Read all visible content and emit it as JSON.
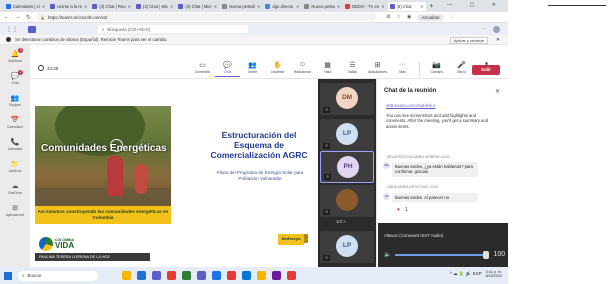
{
  "browser": {
    "tabs": [
      {
        "title": "Calendario | cl",
        "color": "#1a73e8",
        "active": false
      },
      {
        "title": "Unirse a la re",
        "color": "#5b5fc7",
        "active": false
      },
      {
        "title": "(4) Chat | Reu",
        "color": "#5b5fc7",
        "active": false
      },
      {
        "title": "(3) Chat | Mic",
        "color": "#5b5fc7",
        "active": false
      },
      {
        "title": "(3) Chat | Micr",
        "color": "#5b5fc7",
        "active": false
      },
      {
        "title": "Nueva pestañ",
        "color": "#888888",
        "active": false
      },
      {
        "title": "dgo directo",
        "color": "#4285f4",
        "active": false
      },
      {
        "title": "Nueva pesta",
        "color": "#888888",
        "active": false
      },
      {
        "title": "DEDO - TV en",
        "color": "#e53935",
        "active": false
      },
      {
        "title": "(8) Chat",
        "color": "#5b5fc7",
        "active": true
      }
    ],
    "new_tab": "+",
    "window_controls": "— ▢ ✕",
    "url": "https://teams.microsoft.com/v2/",
    "update_label": "Actualizar"
  },
  "teams_header": {
    "search_placeholder": "Búsqueda (Ctrl+Alt+E)",
    "more": "···"
  },
  "banner": {
    "text": "Se detectaron cambios de idioma (Español). Reinicie Teams para ver el cambio.",
    "action": "Aplicar y reiniciar",
    "close": "✕"
  },
  "rail": [
    {
      "icon": "bell-icon",
      "glyph": "🔔",
      "label": "Actividad",
      "badge": "1"
    },
    {
      "icon": "chat-icon",
      "glyph": "💬",
      "label": "Chat",
      "badge": "2"
    },
    {
      "icon": "teams-icon",
      "glyph": "👥",
      "label": "Equipos",
      "badge": ""
    },
    {
      "icon": "calendar-icon",
      "glyph": "📅",
      "label": "Calendario",
      "badge": ""
    },
    {
      "icon": "calls-icon",
      "glyph": "📞",
      "label": "Llamadas",
      "badge": ""
    },
    {
      "icon": "files-icon",
      "glyph": "📁",
      "label": "Archivos",
      "badge": ""
    },
    {
      "icon": "onedrive-icon",
      "glyph": "☁",
      "label": "OneDrive",
      "badge": ""
    },
    {
      "icon": "apps-icon",
      "glyph": "⊞",
      "label": "Aplicaciones",
      "badge": ""
    }
  ],
  "meeting": {
    "timer": "43:35",
    "tools": [
      {
        "icon": "chat-icon",
        "glyph": "💬",
        "label": "Chat",
        "active": true
      },
      {
        "icon": "people-icon",
        "glyph": "👥",
        "label": "Gente",
        "active": false
      },
      {
        "icon": "raise-hand-icon",
        "glyph": "✋",
        "label": "Levantar",
        "active": false
      },
      {
        "icon": "react-icon",
        "glyph": "☺",
        "label": "Reaccionar",
        "active": false
      },
      {
        "icon": "view-icon",
        "glyph": "▦",
        "label": "Vista",
        "active": false
      },
      {
        "icon": "notes-icon",
        "glyph": "☰",
        "label": "Notas",
        "active": false
      },
      {
        "icon": "apps-icon",
        "glyph": "⊞",
        "label": "Aplicaciones",
        "active": false
      },
      {
        "icon": "more-icon",
        "glyph": "···",
        "label": "Más",
        "active": false
      }
    ],
    "extra_label": "Contenido",
    "devices": [
      {
        "icon": "camera-icon",
        "glyph": "📷",
        "label": "Cámara"
      },
      {
        "icon": "mic-icon",
        "glyph": "🎤",
        "label": "Micro"
      },
      {
        "icon": "share-icon",
        "glyph": "⬆",
        "label": "Compartir"
      }
    ],
    "leave_label": "Salir"
  },
  "slide": {
    "photo_title": "Comunidades Energéticas",
    "strip_text": "Así estamos construyendo las comunidades energéticas en Colombia",
    "title": "Estructuración del Esquema de Comercialización AGRC",
    "subtitle": "Piloto del Programa de Energía Solar para Población Vulnerable",
    "logo_small": "COLOMBIA",
    "logo_big": "VIDA",
    "logo_tag": "MinEnergía",
    "presenter": "PAULINA TERESA LLERENA DE LA HOZ"
  },
  "participants": [
    {
      "initials": "DM",
      "bg": "#f2d5c4",
      "fg": "#8a4a2a"
    },
    {
      "initials": "LP",
      "bg": "#cfe0f3",
      "fg": "#2a5a8a"
    },
    {
      "initials": "PH",
      "bg": "#e3d6f2",
      "fg": "#5a3a8a"
    },
    {
      "initials": "",
      "bg": "#8b5a2b",
      "fg": "#ffffff"
    },
    {
      "initials": "LP",
      "bg": "#cfe0f3",
      "fg": "#2a5a8a"
    }
  ],
  "pager": "1/4 >",
  "chat": {
    "title": "Chat de la reunión",
    "close": "✕",
    "link_text": "obtt.source=cm-chat-link-1",
    "recap_text": "You can see screenshots and add highlights and comments. After the meeting, you'll get a summary and action items.",
    "msg1_meta": "DELIA ROCIO ALVAREZ MORENO 14:22",
    "msg1_initials": "DM",
    "msg1_text": "Buenas tardes, ¿ya están hablando? para confirmar, gracias",
    "msg2_meta": "LINDA MARIA ORTIZ RUIZ 14:23",
    "msg2_initials": "LS",
    "msg2_text": "Buenas tardes. Al parecer no.",
    "react1": "♥",
    "react2": "1"
  },
  "audio": {
    "device": "Altavoz (Conexant ISST Audio)",
    "volume": "100",
    "level": 100
  },
  "taskbar": {
    "search": "Buscar",
    "apps": [
      "#f4b400",
      "#1f6fd4",
      "#5b5fc7",
      "#e53935",
      "#2e7d32",
      "#5b5fc7",
      "#1a73e8",
      "#e53935",
      "#0078d4",
      "#f4b400",
      "#6a1b9a",
      "#e53935"
    ],
    "tray": "^ ☁ 🔋 🔊 ESP",
    "time": "3:41 p. m.",
    "date": "8/15/2023"
  }
}
